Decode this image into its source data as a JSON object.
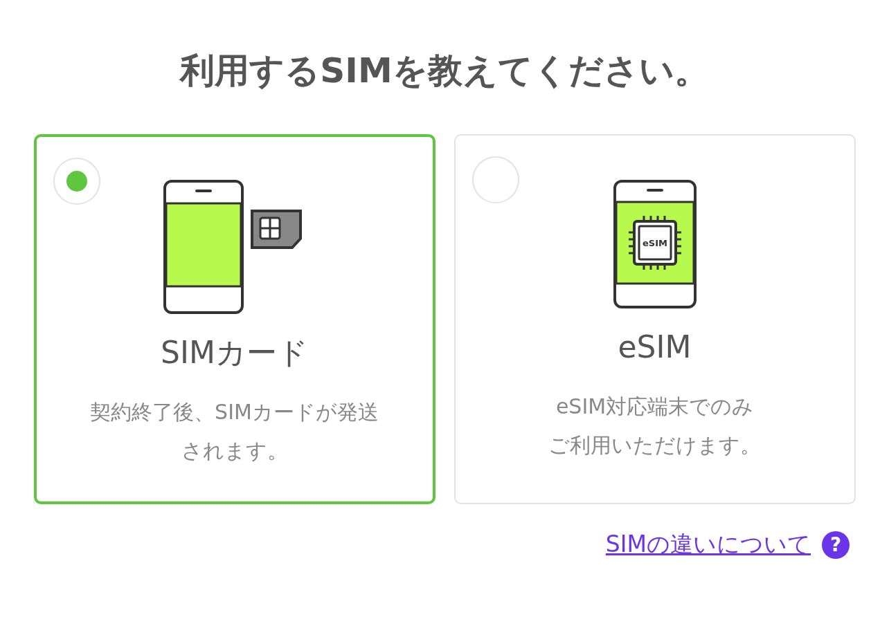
{
  "title": "利用するSIMを教えてください。",
  "options": [
    {
      "kind": "sim-card",
      "selected": true,
      "label": "SIMカード",
      "description_lines": [
        "契約終了後、SIMカードが発送",
        "されます。"
      ]
    },
    {
      "kind": "esim",
      "selected": false,
      "label": "eSIM",
      "chip_label": "eSIM",
      "description_lines": [
        "eSIM対応端末でのみ",
        "ご利用いただけます。"
      ]
    }
  ],
  "help_link": {
    "label": "SIMの違いについて",
    "help_icon": "?"
  }
}
